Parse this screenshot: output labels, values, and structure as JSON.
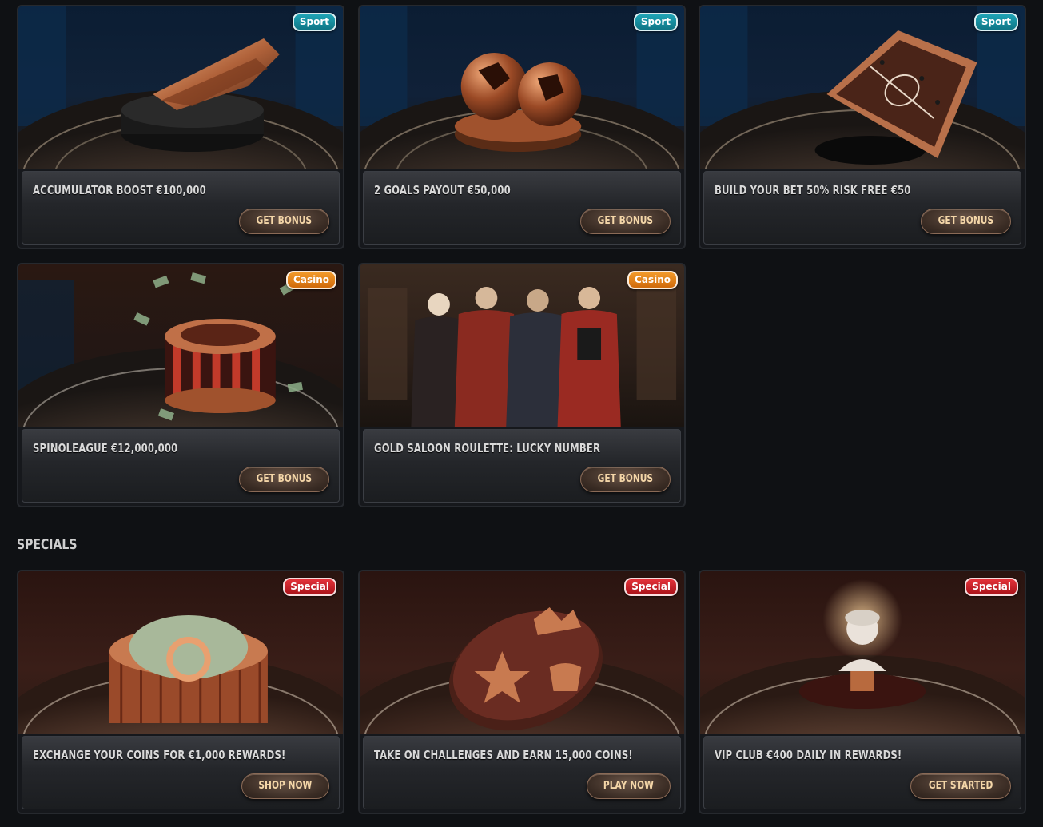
{
  "promotions": [
    {
      "title": "ACCUMULATOR BOOST €100,000",
      "badge": "Sport",
      "cta": "GET BONUS"
    },
    {
      "title": "2 GOALS PAYOUT €50,000",
      "badge": "Sport",
      "cta": "GET BONUS"
    },
    {
      "title": "BUILD YOUR BET 50% RISK FREE €50",
      "badge": "Sport",
      "cta": "GET BONUS"
    },
    {
      "title": "SPINOLEAGUE €12,000,000",
      "badge": "Casino",
      "cta": "GET BONUS"
    },
    {
      "title": "GOLD SALOON ROULETTE: LUCKY NUMBER",
      "badge": "Casino",
      "cta": "GET BONUS"
    }
  ],
  "specials": {
    "heading": "SPECIALS",
    "items": [
      {
        "title": "EXCHANGE YOUR COINS FOR €1,000 REWARDS!",
        "badge": "Special",
        "cta": "SHOP NOW"
      },
      {
        "title": "TAKE ON CHALLENGES AND EARN 15,000 COINS!",
        "badge": "Special",
        "cta": "PLAY NOW"
      },
      {
        "title": "VIP CLUB €400 DAILY IN REWARDS!",
        "badge": "Special",
        "cta": "GET STARTED"
      }
    ]
  },
  "colors": {
    "background": "#0f1114",
    "sport_badge": "#1fa4b6",
    "casino_badge": "#f29a2a",
    "special_badge": "#e3323a",
    "cta_text": "#f4d6a8"
  },
  "images": [
    "golden-football-boot-image",
    "copper-footballs-image",
    "tactics-board-image",
    "roulette-wheel-money-image",
    "saloon-characters-image",
    "cash-stack-coin-image",
    "challenge-badges-image",
    "vip-bust-image"
  ]
}
